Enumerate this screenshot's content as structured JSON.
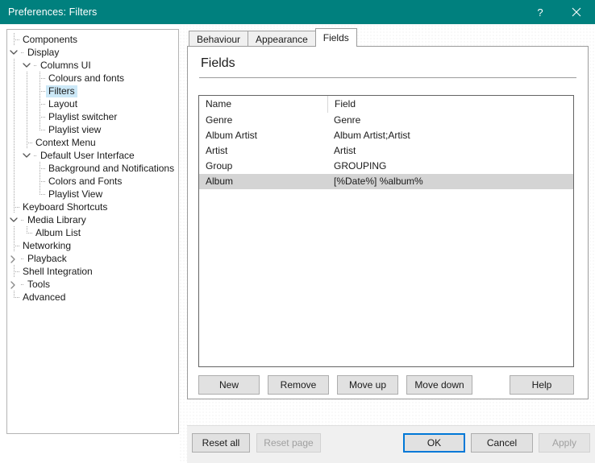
{
  "window": {
    "title": "Preferences: Filters",
    "titlebar_color": "#00807e",
    "help_button": "?",
    "close_button": "×"
  },
  "sidebar": {
    "items": [
      {
        "label": "Components",
        "depth": 0,
        "expander": "none",
        "selected": false
      },
      {
        "label": "Display",
        "depth": 0,
        "expander": "expanded",
        "selected": false
      },
      {
        "label": "Columns UI",
        "depth": 1,
        "expander": "expanded",
        "selected": false
      },
      {
        "label": "Colours and fonts",
        "depth": 2,
        "expander": "none",
        "selected": false
      },
      {
        "label": "Filters",
        "depth": 2,
        "expander": "none",
        "selected": true
      },
      {
        "label": "Layout",
        "depth": 2,
        "expander": "none",
        "selected": false
      },
      {
        "label": "Playlist switcher",
        "depth": 2,
        "expander": "none",
        "selected": false
      },
      {
        "label": "Playlist view",
        "depth": 2,
        "expander": "none",
        "selected": false
      },
      {
        "label": "Context Menu",
        "depth": 1,
        "expander": "none",
        "selected": false
      },
      {
        "label": "Default User Interface",
        "depth": 1,
        "expander": "expanded",
        "selected": false
      },
      {
        "label": "Background and Notifications",
        "depth": 2,
        "expander": "none",
        "selected": false
      },
      {
        "label": "Colors and Fonts",
        "depth": 2,
        "expander": "none",
        "selected": false
      },
      {
        "label": "Playlist View",
        "depth": 2,
        "expander": "none",
        "selected": false
      },
      {
        "label": "Keyboard Shortcuts",
        "depth": 0,
        "expander": "none",
        "selected": false
      },
      {
        "label": "Media Library",
        "depth": 0,
        "expander": "expanded",
        "selected": false
      },
      {
        "label": "Album List",
        "depth": 1,
        "expander": "none",
        "selected": false
      },
      {
        "label": "Networking",
        "depth": 0,
        "expander": "none",
        "selected": false
      },
      {
        "label": "Playback",
        "depth": 0,
        "expander": "collapsed",
        "selected": false
      },
      {
        "label": "Shell Integration",
        "depth": 0,
        "expander": "none",
        "selected": false
      },
      {
        "label": "Tools",
        "depth": 0,
        "expander": "collapsed",
        "selected": false
      },
      {
        "label": "Advanced",
        "depth": 0,
        "expander": "none",
        "selected": false
      }
    ]
  },
  "tabs": [
    {
      "label": "Behaviour",
      "active": false
    },
    {
      "label": "Appearance",
      "active": false
    },
    {
      "label": "Fields",
      "active": true
    }
  ],
  "panel": {
    "title": "Fields"
  },
  "listview": {
    "columns": [
      "Name",
      "Field"
    ],
    "rows": [
      {
        "name": "Genre",
        "field": "Genre",
        "selected": false
      },
      {
        "name": "Album Artist",
        "field": "Album Artist;Artist",
        "selected": false
      },
      {
        "name": "Artist",
        "field": "Artist",
        "selected": false
      },
      {
        "name": "Group",
        "field": "GROUPING",
        "selected": false
      },
      {
        "name": "Album",
        "field": "[%Date%] %album%",
        "selected": true
      }
    ]
  },
  "actions": {
    "new": "New",
    "remove": "Remove",
    "move_up": "Move up",
    "move_down": "Move down",
    "help": "Help"
  },
  "footer": {
    "reset_all": "Reset all",
    "reset_page": "Reset page",
    "ok": "OK",
    "cancel": "Cancel",
    "apply": "Apply",
    "focus_color": "#0078d7"
  }
}
